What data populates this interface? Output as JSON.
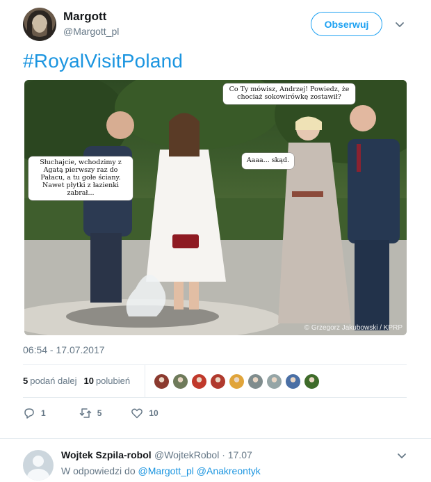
{
  "author": {
    "display_name": "Margott",
    "handle": "@Margott_pl",
    "follow_label": "Obserwuj"
  },
  "tweet": {
    "hashtag": "#RoyalVisitPoland",
    "bubble_left": "Słuchajcie, wchodzimy z Agatą pierwszy raz do Pałacu, a tu gołe ściany. Nawet płytki z łazienki zabrał...",
    "bubble_top": "Co Ty mówisz, Andrzej! Powiedz, że chociaż sokowirówkę zostawił?",
    "bubble_small": "Aaaa... skąd.",
    "photo_credit": "© Grzegorz Jakubowski / KPRP",
    "timestamp": "06:54 - 17.07.2017"
  },
  "stats": {
    "retweets_count": "5",
    "retweets_label": "podań dalej",
    "likes_count": "10",
    "likes_label": "polubień"
  },
  "likers_colors": [
    "#8b3a2f",
    "#6e7a5a",
    "#c0392b",
    "#b03a2e",
    "#e0a43a",
    "#7f8c8d",
    "#95a5a6",
    "#4a6fa5",
    "#3e6b2a"
  ],
  "actions": {
    "reply_count": "1",
    "retweet_count": "5",
    "like_count": "10",
    "reply_icon": "reply-icon",
    "retweet_icon": "retweet-icon",
    "like_icon": "heart-icon"
  },
  "reply": {
    "name": "Wojtek Szpila-robol",
    "meta": "@WojtekRobol · 17.07",
    "to_prefix": "W odpowiedzi do",
    "mention1": "@Margott_pl",
    "mention2": "@Anakreontyk"
  },
  "colors": {
    "accent": "#1da1f2",
    "link": "#1b95e0",
    "muted": "#657786"
  }
}
